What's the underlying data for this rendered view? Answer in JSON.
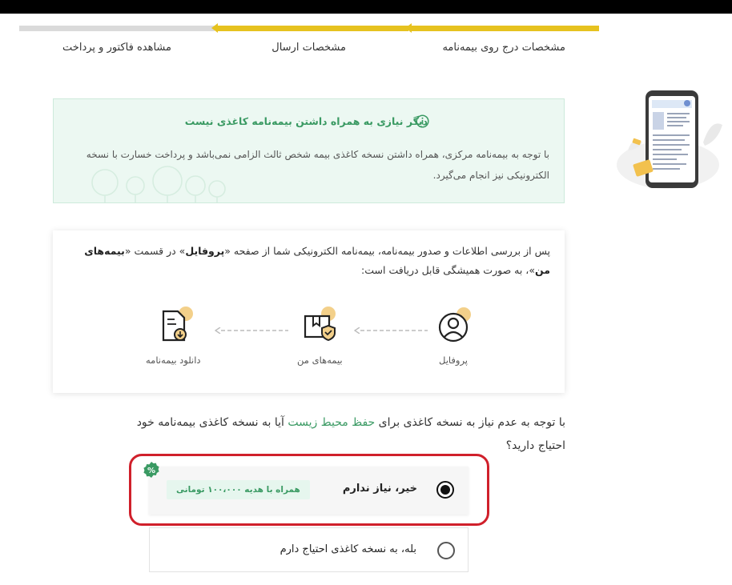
{
  "stepper": {
    "steps": [
      {
        "label": "مشخصات درج روی بیمه‌نامه",
        "state": "done"
      },
      {
        "label": "مشخصات ارسال",
        "state": "current"
      },
      {
        "label": "مشاهده فاکتور و پرداخت",
        "state": "pending"
      }
    ],
    "active_color": "#e6c21f",
    "inactive_color": "#dadada"
  },
  "info_box": {
    "title": "دیگر نیازی به همراه داشتن بیمه‌نامه کاغذی نیست",
    "body": "با توجه به بیمه‌نامه مرکزی، همراه داشتن نسخه کاغذی بیمه شخص ثالث الزامی نمی‌باشد و پرداخت خسارت با نسخه الکترونیکی نیز انجام می‌گیرد.",
    "icon": "info-circle-icon",
    "color": "#3a9a63"
  },
  "profile_card": {
    "text_before": "پس از بررسی اطلاعات و صدور بیمه‌نامه، بیمه‌نامه الکترونیکی شما از صفحه «",
    "profile_word": "پروفایل",
    "text_middle": "» در قسمت «",
    "policies_word": "بیمه‌های من",
    "text_after": "»، به صورت همیشگی قابل دریافت است:",
    "flow": [
      {
        "label": "پروفایل",
        "icon": "user-profile-icon"
      },
      {
        "label": "بیمه‌های من",
        "icon": "insurance-box-shield-icon"
      },
      {
        "label": "دانلود بیمه‌نامه",
        "icon": "document-download-icon"
      }
    ]
  },
  "question": {
    "before": "با توجه به عدم نیاز به نسخه کاغذی برای ",
    "highlight": "حفظ محیط زیست",
    "after": " آیا به نسخه کاغذی بیمه‌نامه خود احتیاج دارید؟"
  },
  "options": {
    "no_paper": {
      "label": "خیر، نیاز ندارم",
      "selected": true,
      "badge": "همراه با هدیه ۱۰۰،۰۰۰ تومانی",
      "discount_icon": "percent-badge-icon"
    },
    "need_paper": {
      "label": "بله، به نسخه کاغذی احتیاج دارم",
      "selected": false
    }
  },
  "side_illustration": {
    "icon": "phone-policy-illustration-icon"
  },
  "colors": {
    "accent_green": "#3a9a63",
    "highlight_red": "#d0202b",
    "icon_yellow": "#f3d08a"
  }
}
